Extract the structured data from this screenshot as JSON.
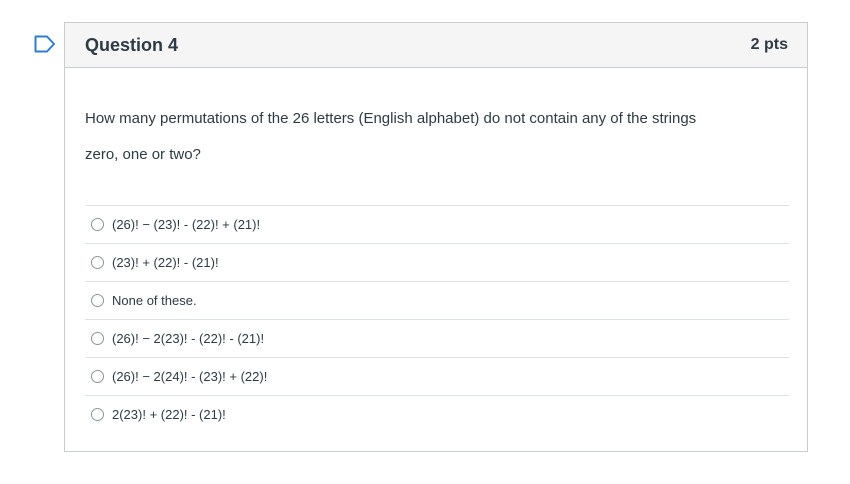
{
  "colors": {
    "flag_accent": "#2d7dd2",
    "header_bg": "#f5f5f5",
    "border": "#c7cdd1",
    "text": "#2d3b45"
  },
  "flag": {
    "icon": "bookmark-flag-icon"
  },
  "question": {
    "title": "Question 4",
    "points": "2 pts",
    "text_line1": "How many permutations of the 26 letters (English alphabet) do not contain any of the strings",
    "text_line2": "zero, one or two?"
  },
  "answers": [
    "(26)! − (23)! - (22)! + (21)!",
    "(23)! + (22)! - (21)!",
    "None of these.",
    "(26)! − 2(23)! - (22)! - (21)!",
    "(26)! − 2(24)! - (23)! + (22)!",
    "2(23)! + (22)! - (21)!"
  ]
}
